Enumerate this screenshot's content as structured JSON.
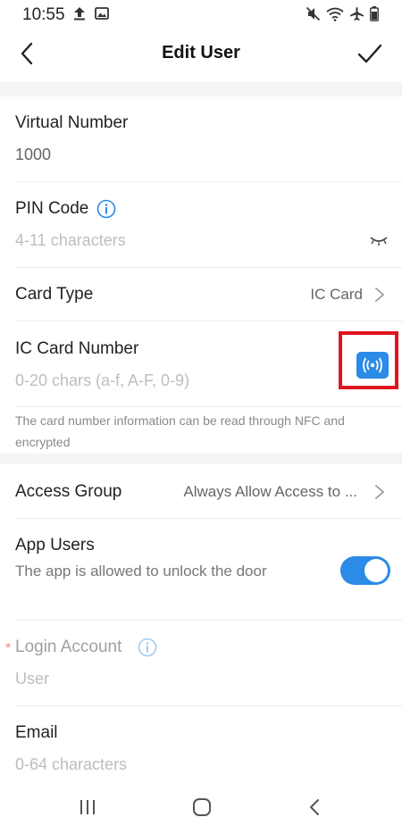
{
  "status_bar": {
    "time": "10:55",
    "icons_left": [
      "upload-icon",
      "image-icon"
    ],
    "icons_right": [
      "mute-icon",
      "wifi-icon",
      "airplane-icon",
      "battery-icon"
    ]
  },
  "header": {
    "title": "Edit User",
    "back_icon": "chevron-left-icon",
    "confirm_icon": "checkmark-icon"
  },
  "form": {
    "virtual_number": {
      "label": "Virtual Number",
      "value": "1000"
    },
    "pin_code": {
      "label": "PIN Code",
      "placeholder": "4-11 characters",
      "info_icon": "info-icon",
      "visibility_icon": "eye-closed-icon"
    },
    "card_type": {
      "label": "Card Type",
      "value": "IC Card"
    },
    "ic_card_number": {
      "label": "IC Card Number",
      "placeholder": "0-20 chars (a-f, A-F, 0-9)",
      "nfc_icon": "nfc-scan-icon"
    },
    "nfc_hint": "The card number information can be read through NFC and encrypted",
    "access_group": {
      "label": "Access Group",
      "value": "Always Allow Access to ..."
    },
    "app_users": {
      "label": "App Users",
      "description": "The app is allowed to unlock the door",
      "enabled": true
    },
    "login_account": {
      "label": "Login Account",
      "required_mark": "*",
      "placeholder": "User"
    },
    "email": {
      "label": "Email",
      "placeholder": "0-64 characters"
    }
  },
  "colors": {
    "accent": "#2b8be6",
    "highlight": "#e0141e",
    "required": "#f08a8a"
  },
  "nav_bar": {
    "icons": [
      "recent-apps-icon",
      "home-icon",
      "back-icon"
    ]
  }
}
